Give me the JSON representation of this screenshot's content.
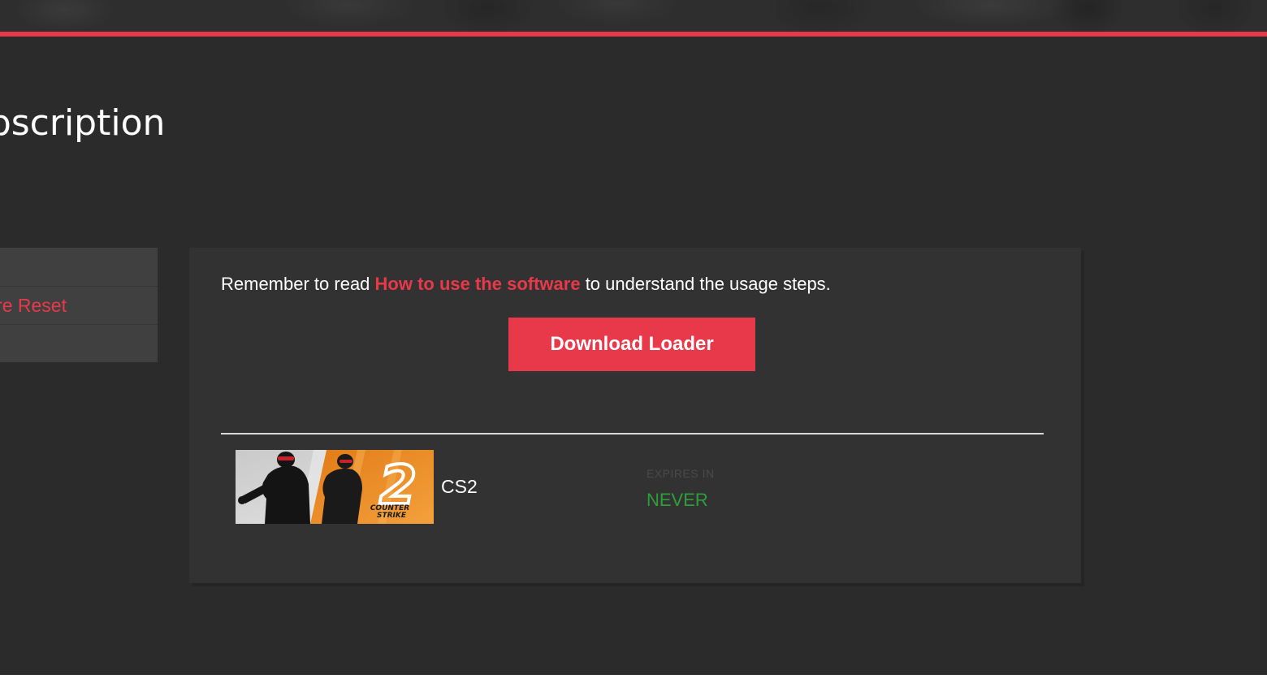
{
  "page": {
    "title": "Subscription"
  },
  "side_menu": {
    "items": [
      {
        "label": ""
      },
      {
        "label": "Hardware Reset"
      },
      {
        "label": ""
      }
    ]
  },
  "panel": {
    "reminder_prefix": "Remember to read ",
    "reminder_link": "How to use the software",
    "reminder_suffix": " to understand the usage steps.",
    "download_button": "Download Loader",
    "subscription": {
      "game_name": "CS2",
      "thumbnail_text_top": "COUNTER",
      "thumbnail_text_bottom": "STRIKE",
      "thumbnail_numeral": "2",
      "expires_label": "EXPIRES IN",
      "expires_value": "NEVER"
    }
  },
  "colors": {
    "background": "#2b2b2b",
    "panel": "#323232",
    "accent": "#e8394a",
    "success": "#2e9e3c",
    "side_menu": "#404040"
  },
  "icons": {
    "game_thumbnail": "counter-strike-2-artwork"
  }
}
